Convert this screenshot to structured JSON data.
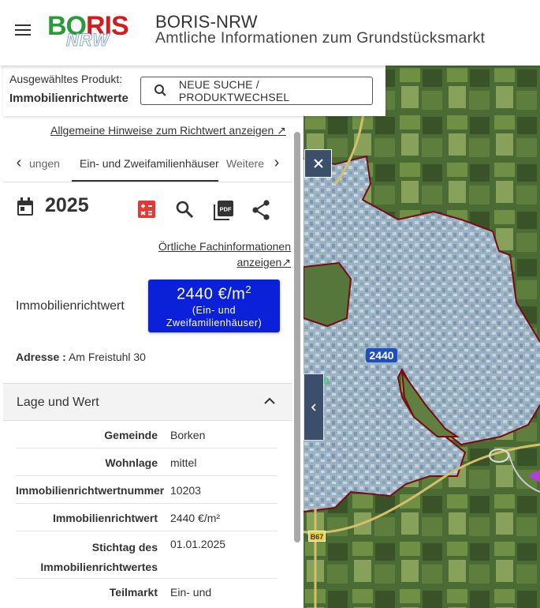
{
  "header": {
    "logo_main": "BORIS",
    "logo_sub": "NRW",
    "title": "BORIS-NRW",
    "subtitle": "Amtliche Informationen zum Grundstücksmarkt"
  },
  "product": {
    "label": "Ausgewähltes Produkt:",
    "value": "Immobilienrichtwerte",
    "search_button": "NEUE SUCHE / PRODUKTWECHSEL"
  },
  "panel": {
    "hint_link": "Allgemeine Hinweise zum Richtwert anzeigen ↗",
    "tabs": [
      {
        "label": "ungen"
      },
      {
        "label": "Ein- und Zweifamilienhäuser"
      },
      {
        "label": "Weitere"
      }
    ],
    "year": "2025",
    "fach_link_line1": "Örtliche Fachinformationen",
    "fach_link_line2": "anzeigen↗",
    "irw_label": "Immobilienrichtwert",
    "badge_value": "2440 €/m",
    "badge_sup": "2",
    "badge_sub1": "(Ein- und",
    "badge_sub2": "Zweifamilienhäuser)",
    "address_key": "Adresse :",
    "address_value": "Am Freistuhl 30",
    "accordion_title": "Lage und Wert",
    "details": [
      {
        "key": "Gemeinde",
        "value": "Borken"
      },
      {
        "key": "Wohnlage",
        "value": "mittel"
      },
      {
        "key": "Immobilienrichtwertnummer",
        "value": "10203"
      },
      {
        "key": "Immobilienrichtwert",
        "value": "2440 €/m²"
      },
      {
        "key1": "Stichtag des",
        "key2": "Immobilienrichtwertes",
        "value": "01.01.2025"
      },
      {
        "key": "Teilmarkt",
        "value": "Ein- und"
      }
    ]
  },
  "map": {
    "value_label": "2440",
    "road_label": "B67",
    "side_label": "0",
    "colors": {
      "zone_overlay": "#a9c4dc",
      "zone_border": "#7a0a10",
      "badge": "#0a21d9"
    }
  },
  "icons": [
    "hamburger-icon",
    "search-icon",
    "chevron-left-icon",
    "chevron-right-icon",
    "calendar-icon",
    "calculator-icon",
    "pdf-icon",
    "share-icon",
    "chevron-up-icon",
    "close-icon"
  ]
}
